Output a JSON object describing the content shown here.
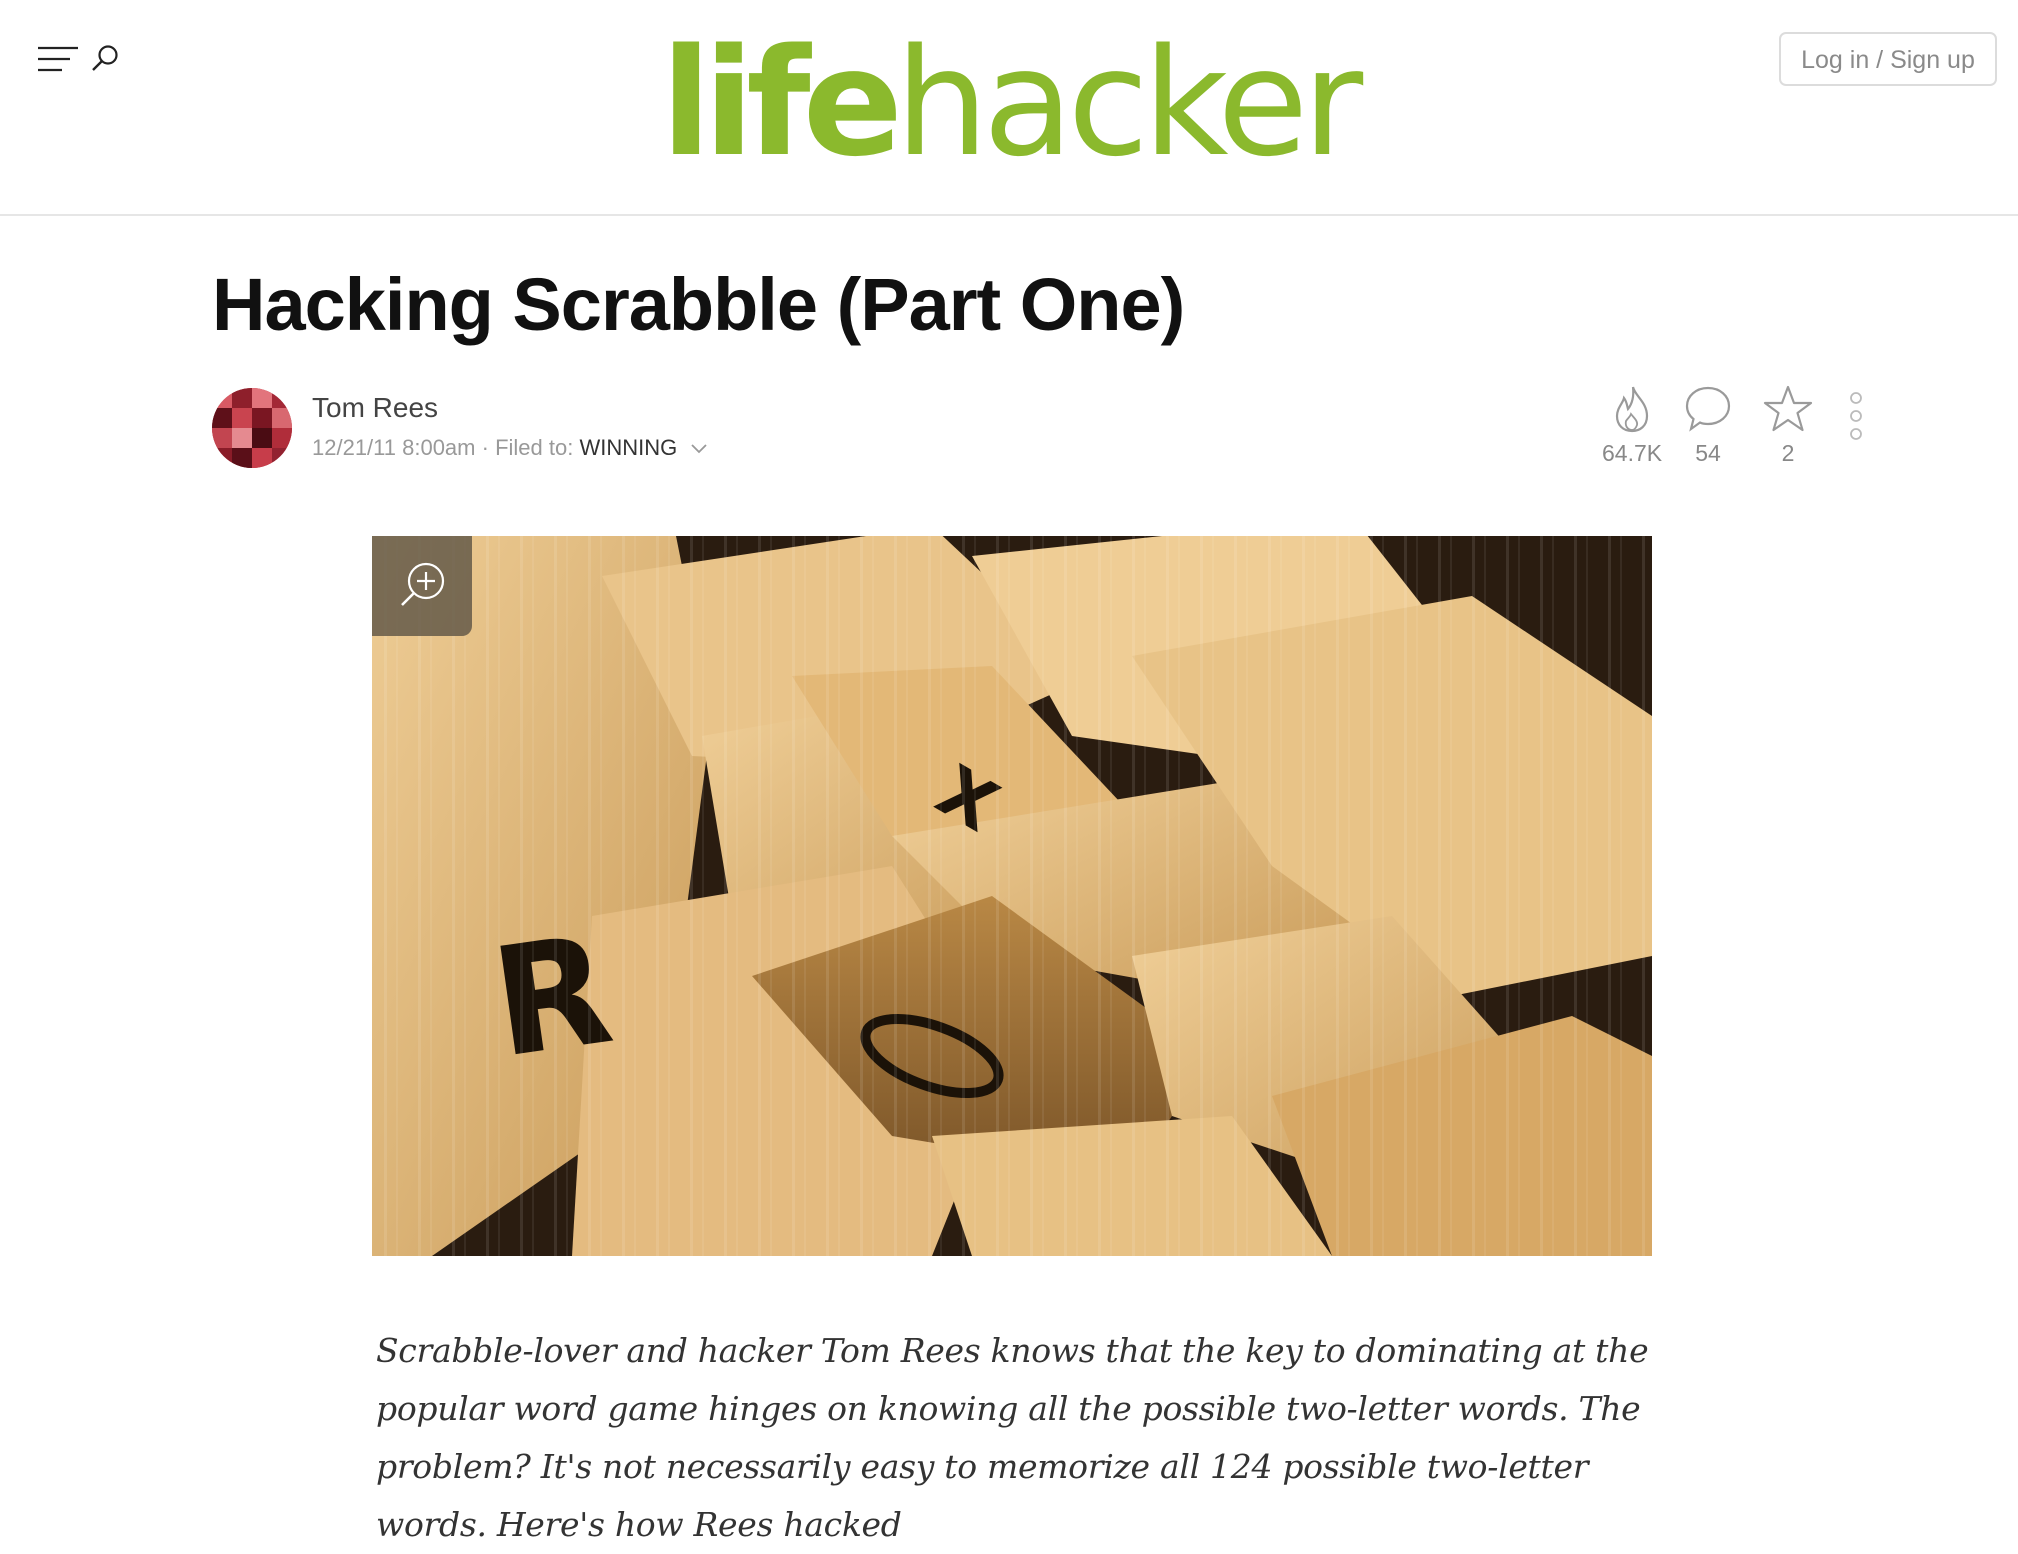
{
  "header": {
    "logo_part1": "life",
    "logo_part2": "hacker",
    "login_label": "Log in / Sign up",
    "brand_color": "#8bb92d"
  },
  "article": {
    "title": "Hacking Scrabble (Part One)",
    "author": "Tom Rees",
    "date": "12/21/11 8:00am",
    "filed_prefix": "Filed to:",
    "filed_tag": "WINNING",
    "stats": {
      "views": "64.7K",
      "comments": "54",
      "stars": "2"
    },
    "intro": "Scrabble-lover and hacker Tom Rees knows that the key to dominating at the popular word game hinges on knowing all the possible two-letter words. The problem? It's not necessarily easy to memorize all 124 possible two-letter words. Here's how Rees hacked"
  },
  "icons": {
    "menu": "hamburger-menu-icon",
    "search": "search-icon",
    "views": "flame-icon",
    "comments": "speech-bubble-icon",
    "stars": "star-icon",
    "more": "vertical-dots-icon",
    "zoom": "zoom-in-icon",
    "filed_dropdown": "chevron-down-icon"
  }
}
